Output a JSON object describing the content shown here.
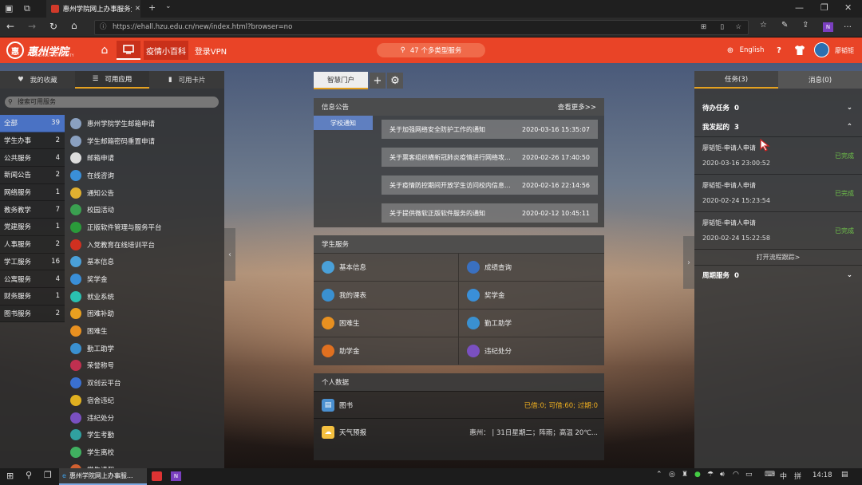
{
  "browser": {
    "tab_title": "惠州学院网上办事服务大厅",
    "url": "https://ehall.hzu.edu.cn/new/index.html?browser=no",
    "profile_badge": "N"
  },
  "header": {
    "logo_text": "惠州学院",
    "logo_en": "HUIZHOU UNIVERSITY",
    "nav_epidemic": "疫情小百科",
    "nav_vpn": "登录VPN",
    "search_label": "47 个多类型服务",
    "language": "English",
    "username": "廖韬钜"
  },
  "left": {
    "tabs": [
      "我的收藏",
      "可用应用",
      "可用卡片"
    ],
    "search_placeholder": "搜索可用服务",
    "categories": [
      {
        "label": "全部",
        "count": "39"
      },
      {
        "label": "学生办事",
        "count": "2"
      },
      {
        "label": "公共服务",
        "count": "4"
      },
      {
        "label": "新闻公告",
        "count": "2"
      },
      {
        "label": "网络服务",
        "count": "1"
      },
      {
        "label": "教务教学",
        "count": "7"
      },
      {
        "label": "党建服务",
        "count": "1"
      },
      {
        "label": "人事服务",
        "count": "2"
      },
      {
        "label": "学工服务",
        "count": "16"
      },
      {
        "label": "公寓服务",
        "count": "4"
      },
      {
        "label": "财务服务",
        "count": "1"
      },
      {
        "label": "图书服务",
        "count": "2"
      }
    ],
    "apps": [
      {
        "label": "惠州学院学生邮箱申请",
        "color": "#8aa0c0",
        "icon": "envelope-icon"
      },
      {
        "label": "学生邮箱密码重置申请",
        "color": "#8aa0c0",
        "icon": "keypad-icon"
      },
      {
        "label": "邮箱申请",
        "color": "#dddddd",
        "icon": "mail-icon"
      },
      {
        "label": "在线咨询",
        "color": "#3a8fd8",
        "icon": "chat-icon"
      },
      {
        "label": "通知公告",
        "color": "#e0b030",
        "icon": "notice-icon"
      },
      {
        "label": "校园活动",
        "color": "#3aa050",
        "icon": "activity-icon"
      },
      {
        "label": "正版软件管理与服务平台",
        "color": "#2a9a3a",
        "icon": "software-icon"
      },
      {
        "label": "入党教育在线培训平台",
        "color": "#d03020",
        "icon": "party-icon"
      },
      {
        "label": "基本信息",
        "color": "#4aa0d8",
        "icon": "profile-icon"
      },
      {
        "label": "奖学金",
        "color": "#3a8fd8",
        "icon": "scholarship-icon"
      },
      {
        "label": "就业系统",
        "color": "#2ac0b0",
        "icon": "job-icon"
      },
      {
        "label": "困难补助",
        "color": "#e8a020",
        "icon": "subsidy-icon"
      },
      {
        "label": "困难生",
        "color": "#e89020",
        "icon": "hardship-icon"
      },
      {
        "label": "勤工助学",
        "color": "#3a90d0",
        "icon": "work-study-icon"
      },
      {
        "label": "荣誉称号",
        "color": "#c03050",
        "icon": "honor-icon"
      },
      {
        "label": "双创云平台",
        "color": "#3a70d0",
        "icon": "cloud-icon"
      },
      {
        "label": "宿舍违纪",
        "color": "#e0b020",
        "icon": "dorm-icon"
      },
      {
        "label": "违纪处分",
        "color": "#7a50c0",
        "icon": "discipline-icon"
      },
      {
        "label": "学生考勤",
        "color": "#30a0a0",
        "icon": "attendance-icon"
      },
      {
        "label": "学生离校",
        "color": "#40b060",
        "icon": "leave-icon"
      },
      {
        "label": "学生请假",
        "color": "#d06030",
        "icon": "request-icon"
      }
    ]
  },
  "middle": {
    "tab_label": "智慧门户",
    "notice": {
      "title": "信息公告",
      "more": "查看更多>>",
      "tab": "学校通知",
      "items": [
        {
          "text": "关于加强网络安全防护工作的通知",
          "date": "2020-03-16 15:35:07"
        },
        {
          "text": "关于票客组织横新冠肺炎疫情进行网络攻...",
          "date": "2020-02-26 17:40:50"
        },
        {
          "text": "关于疫情防控期间开放学生访问校内信息...",
          "date": "2020-02-16 22:14:56"
        },
        {
          "text": "关于提供微软正版软件服务的通知",
          "date": "2020-02-12 10:45:11"
        }
      ]
    },
    "services": {
      "title": "学生服务",
      "items": [
        {
          "label": "基本信息",
          "color": "#4aa0d8",
          "icon": "profile-icon"
        },
        {
          "label": "成绩查询",
          "color": "#3a70c0",
          "icon": "grades-icon"
        },
        {
          "label": "我的课表",
          "color": "#3a90d0",
          "icon": "timetable-icon"
        },
        {
          "label": "奖学金",
          "color": "#3a8fd8",
          "icon": "scholarship-icon"
        },
        {
          "label": "困难生",
          "color": "#e89020",
          "icon": "hardship-icon"
        },
        {
          "label": "勤工助学",
          "color": "#3a90d0",
          "icon": "work-study-icon"
        },
        {
          "label": "助学金",
          "color": "#e07020",
          "icon": "grant-icon"
        },
        {
          "label": "违纪处分",
          "color": "#7a50c0",
          "icon": "discipline-icon"
        }
      ]
    },
    "personal": {
      "title": "个人数据",
      "rows": [
        {
          "label": "图书",
          "value": "已借:0;  可借:60;  过期:0",
          "value_color": "#f0b020"
        },
        {
          "label": "天气预报",
          "value": "惠州：  |  31日星期二；阵雨；高温 20℃...",
          "value_color": "#dddddd"
        }
      ]
    }
  },
  "right": {
    "tabs": [
      "任务(3)",
      "消息(0)"
    ],
    "pending": {
      "label": "待办任务",
      "count": "0"
    },
    "started": {
      "label": "我发起的",
      "count": "3"
    },
    "items": [
      {
        "title": "廖韬钜-申请人申请",
        "date": "2020-03-16 23:00:52",
        "status": "已完成"
      },
      {
        "title": "廖韬钜-申请人申请",
        "date": "2020-02-24 15:23:54",
        "status": "已完成"
      },
      {
        "title": "廖韬钜-申请人申请",
        "date": "2020-02-24 15:22:58",
        "status": "已完成"
      }
    ],
    "open_tracking": "打开流程跟踪>",
    "weekly": {
      "label": "周期服务",
      "count": "0"
    }
  },
  "taskbar": {
    "app_label": "惠州学院网上办事服...",
    "ime": "中",
    "ime2": "拼",
    "time": "14:18"
  }
}
